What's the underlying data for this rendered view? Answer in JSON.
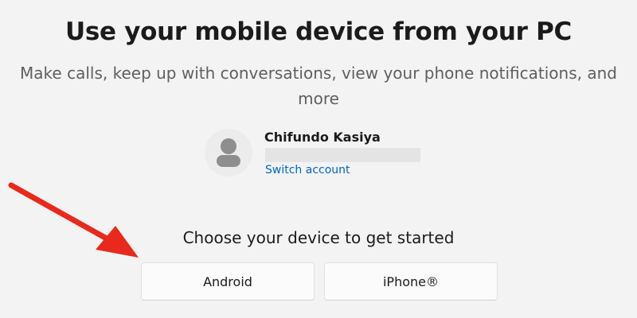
{
  "header": {
    "title": "Use your mobile device from your PC",
    "subtitle": "Make calls, keep up with conversations, view your phone notifications, and more"
  },
  "account": {
    "name": "Chifundo Kasiya",
    "switch_label": "Switch account"
  },
  "devices": {
    "heading": "Choose your device to get started",
    "android_label": "Android",
    "iphone_label": "iPhone®"
  },
  "annotation": {
    "arrow_color": "#e8291c"
  }
}
